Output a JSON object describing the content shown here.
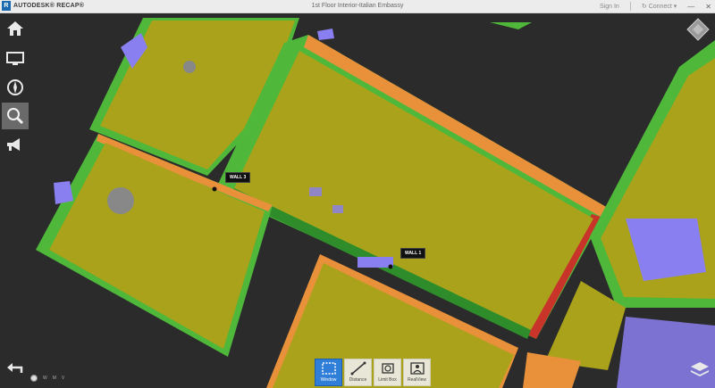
{
  "app": {
    "brand": "AUTODESK® RECAP®",
    "document_title": "1st Floor Interior-Italian Embassy",
    "sign_in": "Sign In",
    "connect": "Connect",
    "window_controls": [
      "minimize-icon",
      "close-icon"
    ]
  },
  "sidebar": {
    "items": [
      {
        "name": "home",
        "icon": "home-icon"
      },
      {
        "name": "display",
        "icon": "monitor-icon"
      },
      {
        "name": "navigation",
        "icon": "compass-icon"
      },
      {
        "name": "search",
        "icon": "magnifier-icon",
        "active": true
      },
      {
        "name": "announce",
        "icon": "megaphone-icon"
      }
    ],
    "bottom_icon": "undo-arrow-icon"
  },
  "viewport": {
    "labels": [
      {
        "text": "WALL 3"
      },
      {
        "text": "WALL 1"
      }
    ],
    "colors": {
      "background": "#2b2b2b",
      "floor": "#a9a21a",
      "wall_green": "#4fb83a",
      "wall_red": "#c8332a",
      "wall_orange": "#e8913a",
      "violet": "#8a7ff0"
    }
  },
  "toolbar": {
    "tools": [
      {
        "label": "Window",
        "icon": "window-select-icon",
        "active": true
      },
      {
        "label": "Distance",
        "icon": "distance-icon"
      },
      {
        "label": "Limit Box",
        "icon": "limit-box-icon"
      },
      {
        "label": "RealView",
        "icon": "realview-icon"
      }
    ]
  },
  "status": {
    "items": [
      "W",
      "M",
      "V"
    ]
  },
  "view_cube_icon": "view-cube-icon",
  "layers_icon": "layers-icon"
}
